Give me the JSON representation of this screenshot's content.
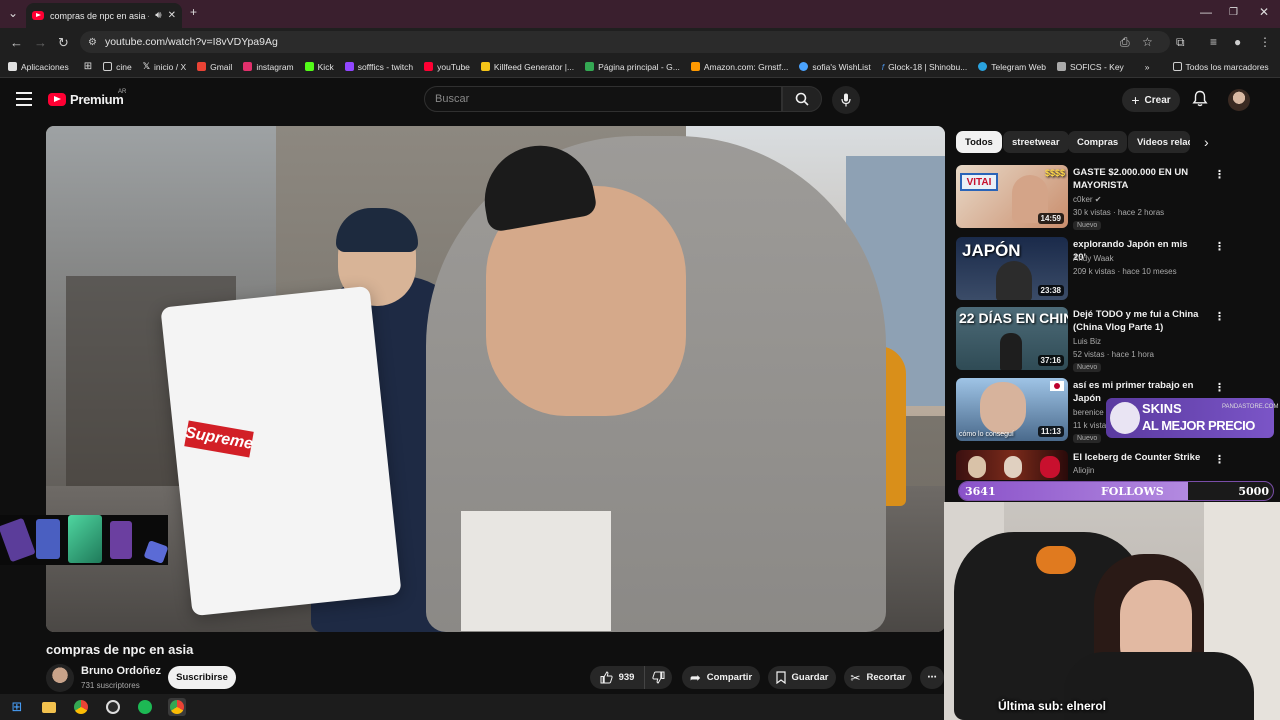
{
  "browser": {
    "tab_title": "compras de npc en asia - Y",
    "url": "youtube.com/watch?v=I8vVDYpa9Ag",
    "bookmarks": [
      {
        "label": "Aplicaciones",
        "icon": "apps-grid-icon",
        "color": "#e0e0e0"
      },
      {
        "label": "cine",
        "icon": "folder-icon",
        "color": "#cfcfcf"
      },
      {
        "label": "inicio / X",
        "icon": "x-logo-icon",
        "color": "#ffffff"
      },
      {
        "label": "Gmail",
        "icon": "gmail-icon",
        "color": "#ea4335"
      },
      {
        "label": "instagram",
        "icon": "instagram-icon",
        "color": "#e1306c"
      },
      {
        "label": "Kick",
        "icon": "kick-icon",
        "color": "#53fc18"
      },
      {
        "label": "sofffics - twitch",
        "icon": "twitch-icon",
        "color": "#9146ff"
      },
      {
        "label": "youTube",
        "icon": "youtube-icon",
        "color": "#ff0033"
      },
      {
        "label": "Killfeed Generator |...",
        "icon": "killfeed-icon",
        "color": "#f5c518"
      },
      {
        "label": "Página principal - G...",
        "icon": "drive-icon",
        "color": "#34a853"
      },
      {
        "label": "Amazon.com: Grnstf...",
        "icon": "amazon-icon",
        "color": "#ff9900"
      },
      {
        "label": "sofia's WishList",
        "icon": "wishlist-icon",
        "color": "#4aa3ff"
      },
      {
        "label": "Glock-18 | Shinobu...",
        "icon": "f-icon",
        "color": "#4a90e2"
      },
      {
        "label": "Telegram Web",
        "icon": "telegram-icon",
        "color": "#2aa3df"
      },
      {
        "label": "SOFICS - Key",
        "icon": "key-icon",
        "color": "#aaaaaa"
      }
    ],
    "all_bookmarks": "Todos los marcadores"
  },
  "header": {
    "logo_text": "Premium",
    "country_code": "AR",
    "search_placeholder": "Buscar",
    "create_label": "Crear"
  },
  "video": {
    "title": "compras de npc en asia",
    "channel": "Bruno Ordoñez",
    "subscribers": "731 suscriptores",
    "subscribe_label": "Suscribirse",
    "likes": "939",
    "share_label": "Compartir",
    "save_label": "Guardar",
    "clip_label": "Recortar"
  },
  "chips": [
    {
      "label": "Todos",
      "active": true
    },
    {
      "label": "streetwear",
      "active": false
    },
    {
      "label": "Compras",
      "active": false
    },
    {
      "label": "Videos relac",
      "active": false
    }
  ],
  "recommendations": [
    {
      "title": "GASTE $2.000.000 EN UN MAYORISTA",
      "channel": "c0ker",
      "meta": "30 k vistas · hace 2 horas",
      "badge": "Nuevo",
      "duration": "14:59",
      "thumb_text": "$$$$"
    },
    {
      "title": "explorando Japón en mis 20'",
      "channel": "Andy Waak",
      "meta": "209 k vistas · hace 10 meses",
      "badge": "",
      "duration": "23:38",
      "thumb_text": "JAPÓN"
    },
    {
      "title": "Dejé TODO y me fui a China (China Vlog Parte 1)",
      "channel": "Luis Biz",
      "meta": "52 vistas · hace 1 hora",
      "badge": "Nuevo",
      "duration": "37:16",
      "thumb_text": "22 DÍAS EN CHINA"
    },
    {
      "title": "así es mi primer trabajo en Japón",
      "channel": "berenice",
      "meta": "11 k vista",
      "badge": "Nuevo",
      "duration": "11:13",
      "thumb_text": "cómo lo conseguí"
    },
    {
      "title": "El Iceberg de Counter Strike",
      "channel": "Aliojin",
      "meta": "",
      "badge": "",
      "duration": "",
      "thumb_text": ""
    }
  ],
  "overlay": {
    "follows_current": "3641",
    "follows_label": "FOLLOWS",
    "follows_goal": "5000",
    "follows_progress": 0.728,
    "skins_line1": "SKINS",
    "skins_line2": "AL MEJOR PRECIO",
    "skins_site": "PANDASTORE.COM",
    "last_sub": "Última sub: elnerol"
  },
  "video_overlay_text": "Supreme",
  "colors": {
    "accent": "#ff0033",
    "tab_strip": "#3a1f2e",
    "follows_fill": "#8a52c9"
  }
}
